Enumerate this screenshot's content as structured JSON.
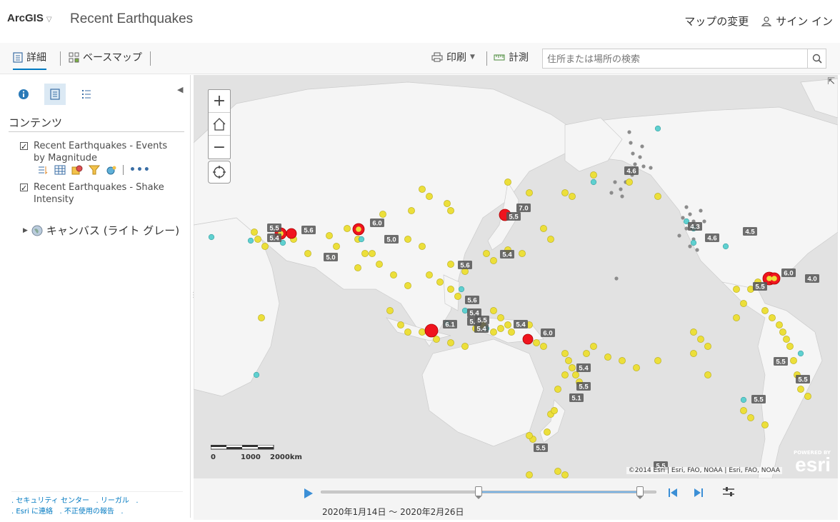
{
  "header": {
    "brand": "ArcGIS",
    "title": "Recent Earthquakes",
    "modify_map": "マップの変更",
    "sign_in": "サイン イン"
  },
  "toolbar": {
    "details": "詳細",
    "basemap": "ベースマップ",
    "print": "印刷",
    "measure": "計測",
    "search_placeholder": "住所または場所の検索"
  },
  "sidebar": {
    "contents_title": "コンテンツ",
    "layers": [
      {
        "label": "Recent Earthquakes - Events by Magnitude",
        "checked": true
      },
      {
        "label": "Recent Earthquakes - Shake Intensity",
        "checked": true
      }
    ],
    "basemap_layer": "キャンバス (ライト グレー)",
    "footer": {
      "link1": "セキュリティ センター",
      "link2": "リーガル",
      "link3": "Esri に連絡",
      "link4": "不正使用の報告"
    }
  },
  "map": {
    "scale_labels": [
      "0",
      "1000",
      "2000km"
    ],
    "attribution": "©2014 Esri | Esri, FAO, NOAA | Esri, FAO, NOAA",
    "powered_by": "POWERED BY",
    "esri": "esri",
    "quake_labels": [
      "5.5",
      "5.4",
      "5.6",
      "6.0",
      "5.0",
      "5.0",
      "5.6",
      "7.0",
      "5.5",
      "5.4",
      "5.6",
      "5.4",
      "5.4",
      "5.5",
      "5.4",
      "6.1",
      "5.4",
      "6.0",
      "5.4",
      "5.5",
      "5.1",
      "5.5",
      "5.5",
      "4.6",
      "4.3",
      "4.6",
      "4.5",
      "6.0",
      "5.5",
      "4.0",
      "5.5",
      "5.5",
      "5.5"
    ]
  },
  "time_slider": {
    "range_text": "2020年1月14日 ～ 2020年2月26日",
    "start_fraction": 0.47,
    "end_fraction": 1.0
  },
  "colors": {
    "major": "#f0141e",
    "moderate": "#ecdf3a",
    "minor": "#5fd0d0",
    "small": "#8c8c8c",
    "accent": "#0079c1"
  }
}
